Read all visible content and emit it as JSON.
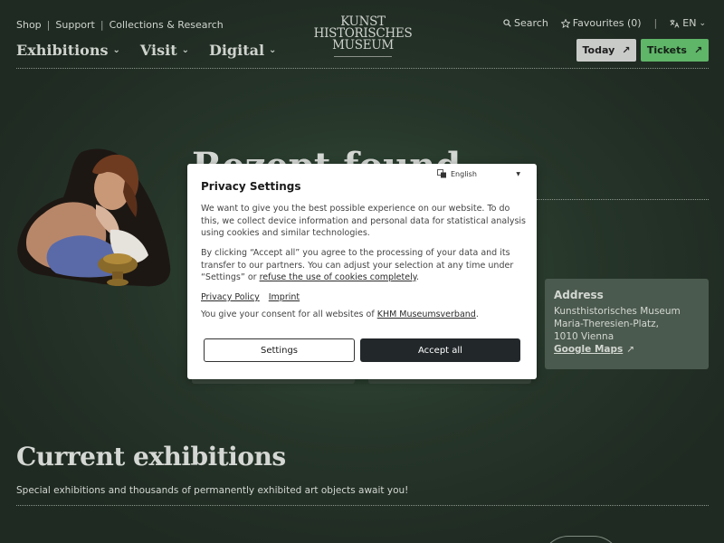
{
  "header": {
    "utility_links": [
      "Shop",
      "Support",
      "Collections & Research"
    ],
    "utility_separator": "|",
    "main_nav": [
      {
        "label": "Exhibitions"
      },
      {
        "label": "Visit"
      },
      {
        "label": "Digital"
      }
    ],
    "logo_lines": [
      "KUNST",
      "HISTORISCHES",
      "MUSEUM"
    ],
    "search_label": "Search",
    "favourites_label": "Favourites (0)",
    "language_label": "EN",
    "separator": "|",
    "today_label": "Today",
    "tickets_label": "Tickets",
    "arrow_glyph": "↗",
    "chevron_glyph": "⌄"
  },
  "hero": {
    "title": "Rezept found"
  },
  "address": {
    "heading": "Address",
    "lines": [
      "Kunsthistorisches Museum",
      "Maria-Theresien-Platz,",
      "1010 Vienna"
    ],
    "maps_label": "Google Maps",
    "maps_arrow": "↗"
  },
  "section": {
    "title": "Current exhibitions",
    "subtitle": "Special exhibitions and thousands of permanently exhibited art objects await you!"
  },
  "privacy_modal": {
    "language_select": "English",
    "title": "Privacy Settings",
    "paragraph1": "We want to give you the best possible experience on our website. To do this, we collect device information and personal data for statistical analysis using cookies and similar technologies.",
    "paragraph2_text": "By clicking “Accept all” you agree to the processing of your data and its transfer to our partners. You can adjust your selection at any time under “Settings” or",
    "paragraph2_link": "refuse the use of cookies completely",
    "paragraph2_end": ".",
    "privacy_policy_label": "Privacy Policy",
    "imprint_label": "Imprint",
    "consent_text": "You give your consent for all websites of",
    "consent_link": "KHM Museumsverband",
    "consent_end": ".",
    "settings_label": "Settings",
    "accept_label": "Accept all"
  },
  "colors": {
    "background": "#2b3a2e",
    "tickets_green": "#5fb568",
    "today_grey": "#c9cbc9",
    "accept_dark": "#22272a",
    "address_card": "#4b5a4e"
  }
}
